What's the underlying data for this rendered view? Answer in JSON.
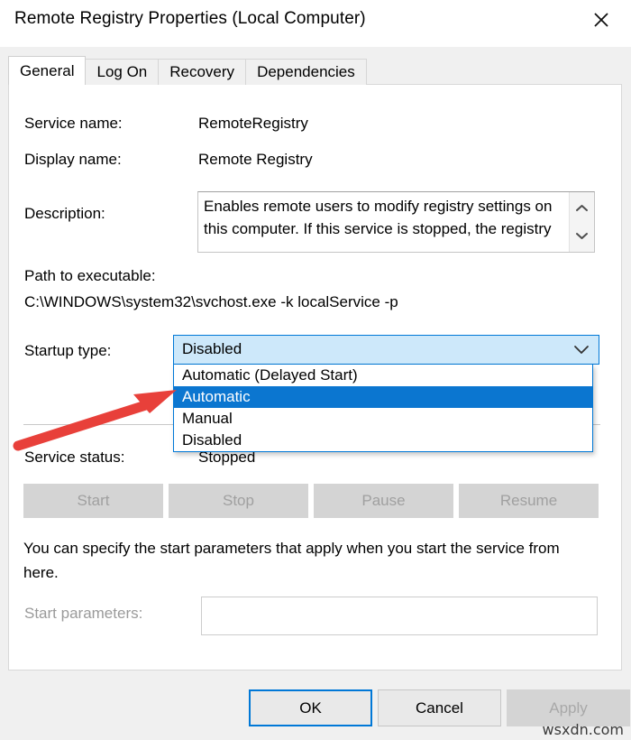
{
  "window": {
    "title": "Remote Registry Properties (Local Computer)",
    "close_icon": "close-icon"
  },
  "tabs": [
    {
      "label": "General",
      "selected": true
    },
    {
      "label": "Log On",
      "selected": false
    },
    {
      "label": "Recovery",
      "selected": false
    },
    {
      "label": "Dependencies",
      "selected": false
    }
  ],
  "general": {
    "service_name_label": "Service name:",
    "service_name_value": "RemoteRegistry",
    "display_name_label": "Display name:",
    "display_name_value": "Remote Registry",
    "description_label": "Description:",
    "description_value": "Enables remote users to modify registry settings on this computer. If this service is stopped, the registry",
    "path_label": "Path to executable:",
    "path_value": "C:\\WINDOWS\\system32\\svchost.exe -k localService -p",
    "startup_type_label": "Startup type:",
    "startup_type_value": "Disabled",
    "startup_type_options": [
      {
        "label": "Automatic (Delayed Start)",
        "selected": false
      },
      {
        "label": "Automatic",
        "selected": true
      },
      {
        "label": "Manual",
        "selected": false
      },
      {
        "label": "Disabled",
        "selected": false
      }
    ],
    "service_status_label": "Service status:",
    "service_status_value": "Stopped",
    "action_buttons": [
      {
        "label": "Start",
        "enabled": false
      },
      {
        "label": "Stop",
        "enabled": false
      },
      {
        "label": "Pause",
        "enabled": false
      },
      {
        "label": "Resume",
        "enabled": false
      }
    ],
    "help_text": "You can specify the start parameters that apply when you start the service from here.",
    "start_parameters_label": "Start parameters:",
    "start_parameters_value": ""
  },
  "footer": {
    "ok_label": "OK",
    "cancel_label": "Cancel",
    "apply_label": "Apply"
  },
  "watermark": "wsxdn.com",
  "colors": {
    "accent": "#0078d7",
    "highlight": "#0b76d0",
    "combo_fill": "#cde8fa",
    "annotation_red": "#e8403a"
  }
}
